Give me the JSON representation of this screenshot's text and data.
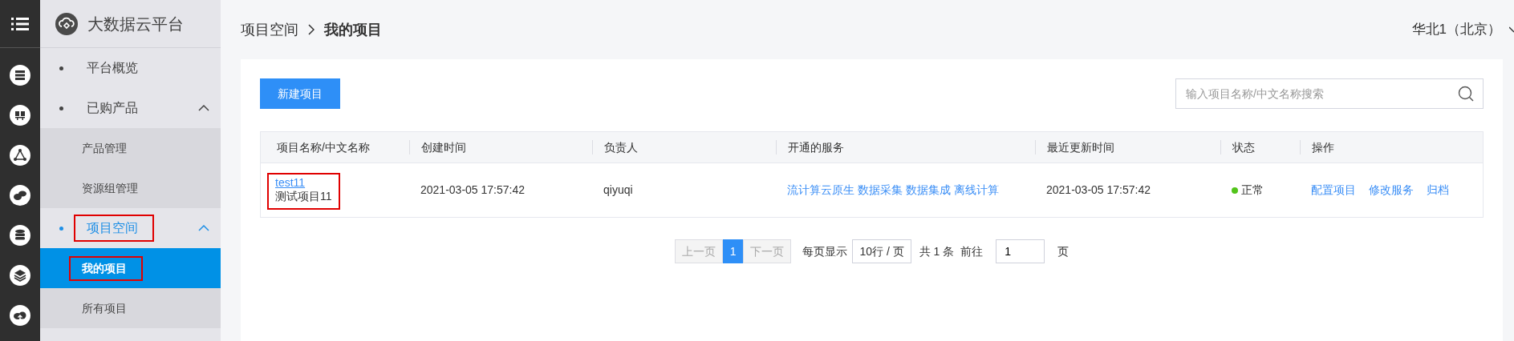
{
  "sidebar": {
    "title": "大数据云平台",
    "items": [
      {
        "label": "平台概览",
        "active": false,
        "highlighted": false
      },
      {
        "label": "已购产品",
        "active": false,
        "expanded": true,
        "highlighted": false,
        "children": [
          {
            "label": "产品管理",
            "selected": false,
            "highlighted": false
          },
          {
            "label": "资源组管理",
            "selected": false,
            "highlighted": false
          }
        ]
      },
      {
        "label": "项目空间",
        "active": true,
        "expanded": true,
        "highlighted": true,
        "children": [
          {
            "label": "我的项目",
            "selected": true,
            "highlighted": true
          },
          {
            "label": "所有项目",
            "selected": false,
            "highlighted": false
          }
        ]
      }
    ]
  },
  "header": {
    "breadcrumb": [
      "项目空间",
      "我的项目"
    ],
    "region": "华北1（北京）"
  },
  "toolbar": {
    "new_button": "新建项目",
    "search": {
      "placeholder": "输入项目名称/中文名称搜索"
    }
  },
  "table": {
    "columns": [
      "项目名称/中文名称",
      "创建时间",
      "负责人",
      "开通的服务",
      "最近更新时间",
      "状态",
      "操作"
    ],
    "rows": [
      {
        "name": "test11",
        "name_highlighted": true,
        "cn_name": "测试项目11",
        "created": "2021-03-05 17:57:42",
        "owner": "qiyuqi",
        "services": [
          "流计算云原生",
          "数据采集",
          "数据集成",
          "离线计算"
        ],
        "updated": "2021-03-05 17:57:42",
        "status": {
          "label": "正常",
          "color": "#52c41a"
        },
        "actions": [
          "配置项目",
          "修改服务",
          "归档"
        ]
      }
    ]
  },
  "pagination": {
    "prev": {
      "label": "上一页",
      "disabled": true
    },
    "pages": [
      {
        "label": "1",
        "selected": true
      }
    ],
    "next": {
      "label": "下一页",
      "disabled": true
    },
    "per_page_label": "每页显示",
    "per_page": "10行 / 页",
    "total": "共 1 条",
    "goto_label": "前往",
    "goto_value": "1",
    "page_suffix": "页"
  }
}
